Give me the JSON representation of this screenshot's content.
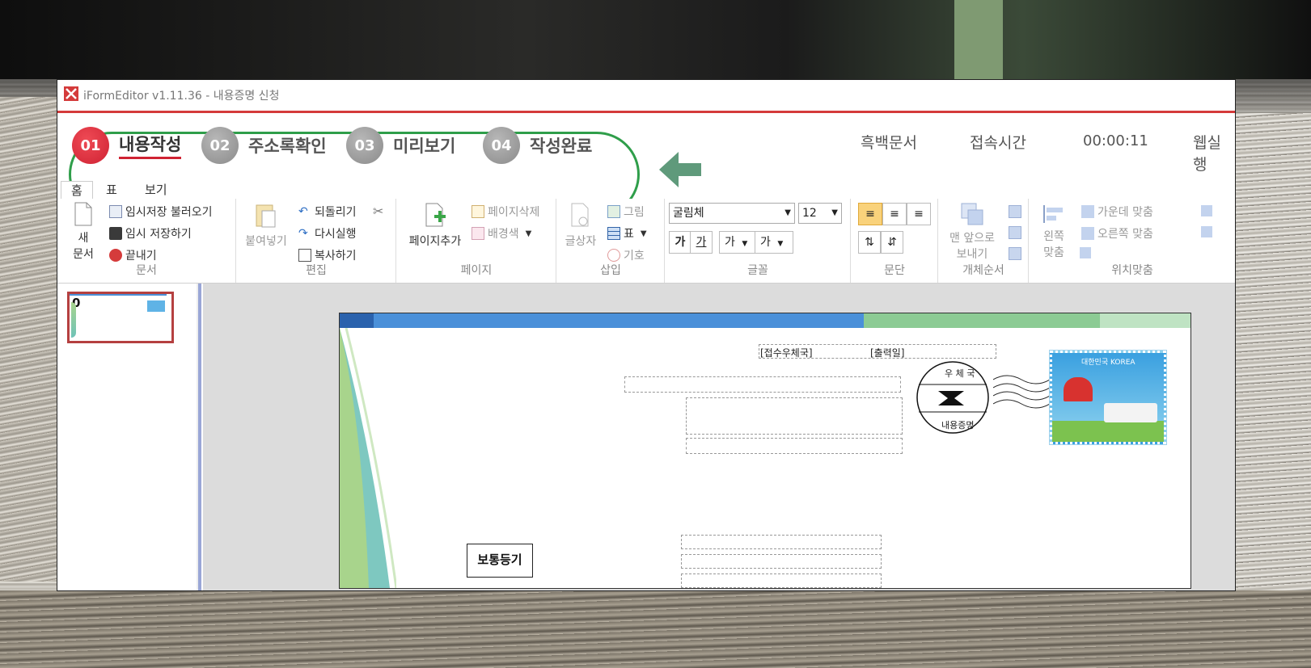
{
  "window": {
    "title": "iFormEditor v1.11.36 - 내용증명 신청"
  },
  "steps": [
    {
      "number": "01",
      "label": "내용작성",
      "active": true
    },
    {
      "number": "02",
      "label": "주소록확인",
      "active": false
    },
    {
      "number": "03",
      "label": "미리보기",
      "active": false
    },
    {
      "number": "04",
      "label": "작성완료",
      "active": false
    }
  ],
  "topinfo": {
    "mono_doc": "흑백문서",
    "access_time_label": "접속시간",
    "access_time_value": "00:00:11",
    "web_partial": "웹실행"
  },
  "tabs": [
    "홈",
    "표",
    "보기"
  ],
  "ribbon": {
    "document": {
      "group_label": "문서",
      "new_label_1": "새",
      "new_label_2": "문서",
      "load_temp": "임시저장 불러오기",
      "save_temp": "임시 저장하기",
      "close": "끝내기"
    },
    "edit": {
      "group_label": "편집",
      "paste": "붙여넣기",
      "undo": "되돌리기",
      "redo": "다시실행",
      "copy": "복사하기"
    },
    "page": {
      "group_label": "페이지",
      "add_page": "페이지추가",
      "delete_page": "페이지삭제",
      "bg_color": "배경색"
    },
    "insert": {
      "group_label": "삽입",
      "textbox": "글상자",
      "image": "그림",
      "table": "표",
      "symbol": "기호"
    },
    "font": {
      "group_label": "글꼴",
      "family": "굴림체",
      "size": "12",
      "bold": "가",
      "underline": "가",
      "color_a": "가",
      "color_b": "가"
    },
    "paragraph": {
      "group_label": "문단"
    },
    "order": {
      "group_label": "개체순서",
      "front_1": "맨 앞으로",
      "front_2": "보내기"
    },
    "align": {
      "group_label": "위치맞춤",
      "left_1": "왼쪽",
      "left_2": "맞춤",
      "center": "가운데 맞춤",
      "right": "오른쪽 맞춤"
    }
  },
  "thumbnail": {
    "page_number": "0"
  },
  "document": {
    "receiving_office": "[접수우체국]",
    "print_date": "[출력일]",
    "postmark_top": "우 체 국",
    "postmark_bottom": "내용증명",
    "stamp_text": "대한민국 KOREA",
    "registered_mail": "보통등기"
  },
  "colors": {
    "accent_red": "#cf2233",
    "oval_green": "#2f9e4a",
    "arrow_green": "#5f9a7b",
    "doc_bar_blue": "#4a90d9",
    "doc_bar_green": "#8ccb94"
  }
}
